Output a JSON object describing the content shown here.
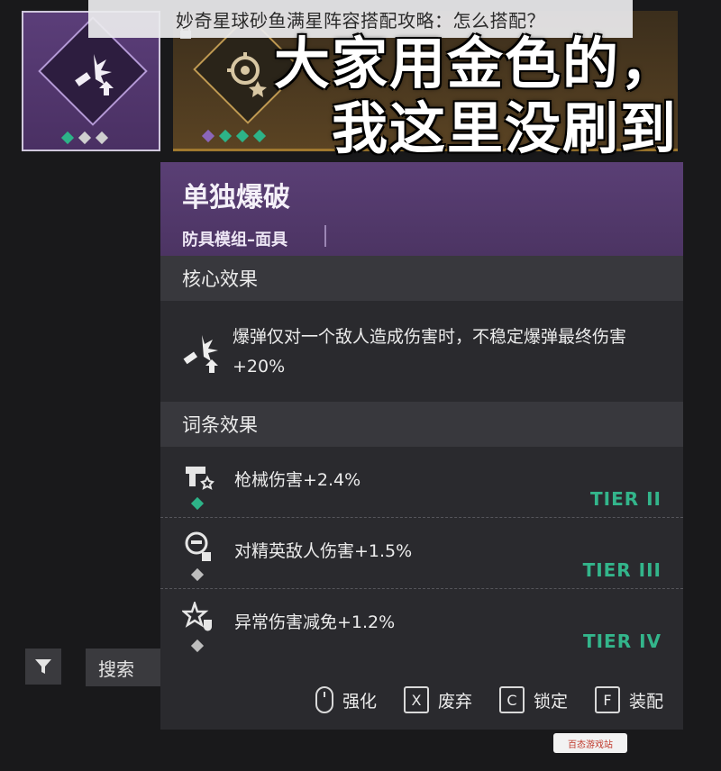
{
  "caption": "妙奇星球砂鱼满星阵容搭配攻略：怎么搭配？",
  "overlay": {
    "line1": "大家用金色的，",
    "line2": "我这里没刷到"
  },
  "item": {
    "name": "单独爆破",
    "type": "防具模组–面具"
  },
  "core": {
    "title": "核心效果",
    "text": "爆弹仅对一个敌人造成伤害时，不稳定爆弹最终伤害+20%"
  },
  "affixes": {
    "title": "词条效果",
    "rows": [
      {
        "label": "枪械伤害+2.4%",
        "tier": "TIER II",
        "icon": "gun-icon",
        "gem": "green"
      },
      {
        "label": "对精英敌人伤害+1.5%",
        "tier": "TIER III",
        "icon": "elite-enemy-icon",
        "gem": "grey"
      },
      {
        "label": "异常伤害减免+1.2%",
        "tier": "TIER IV",
        "icon": "anomaly-shield-icon",
        "gem": "grey"
      }
    ]
  },
  "actions": [
    {
      "key": "",
      "label": "强化",
      "icon": "mouse-icon"
    },
    {
      "key": "X",
      "label": "废弃"
    },
    {
      "key": "C",
      "label": "锁定"
    },
    {
      "key": "F",
      "label": "装配"
    }
  ],
  "controls": {
    "search_label": "搜索"
  },
  "watermark": "百态游戏站",
  "colors": {
    "accent_purple": "#5a3f75",
    "tier_green": "#33b58b",
    "gold": "#a0792f"
  }
}
